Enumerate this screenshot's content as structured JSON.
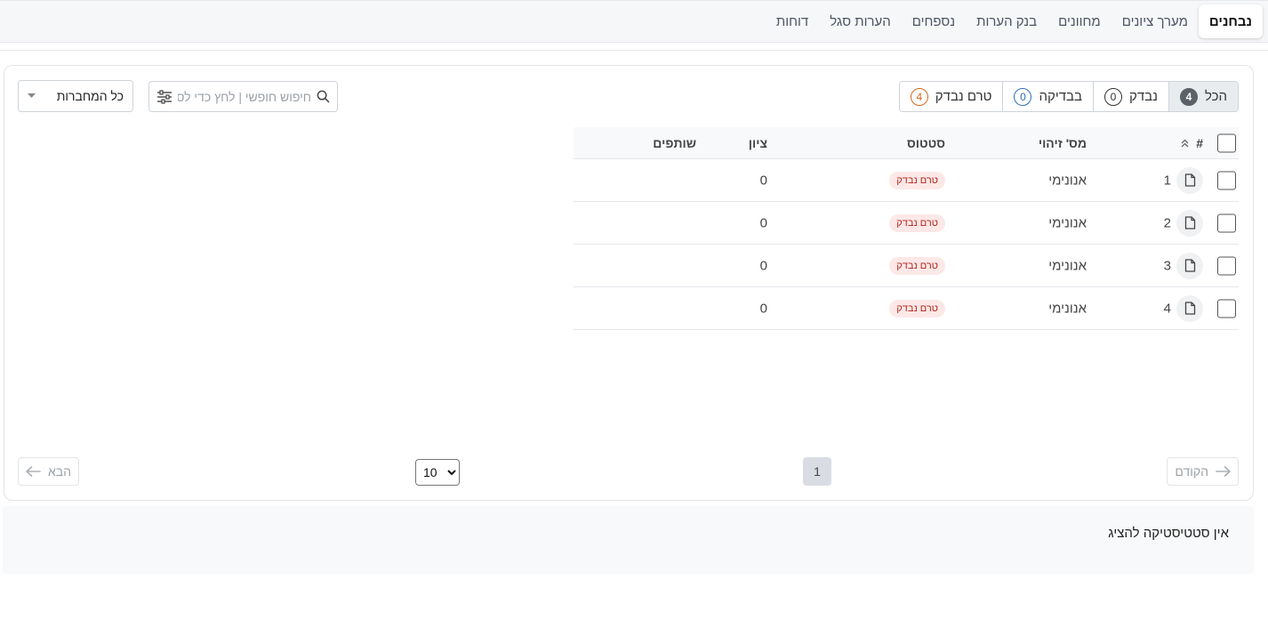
{
  "tabs": [
    {
      "label": "נבחנים",
      "active": true
    },
    {
      "label": "מערך ציונים"
    },
    {
      "label": "מחוונים"
    },
    {
      "label": "בנק הערות"
    },
    {
      "label": "נספחים"
    },
    {
      "label": "הערות סגל"
    },
    {
      "label": "דוחות"
    }
  ],
  "filters": [
    {
      "label": "הכל",
      "count": "4",
      "active": true
    },
    {
      "label": "נבדק",
      "count": "0"
    },
    {
      "label": "בבדיקה",
      "count": "0"
    },
    {
      "label": "טרם נבדק",
      "count": "4"
    }
  ],
  "search": {
    "placeholder": "חיפוש חופשי | לחץ כדי לסנן"
  },
  "notebook_select": {
    "value": "כל המחברות"
  },
  "table": {
    "headers": {
      "num": "#",
      "id": "מס' זיהוי",
      "status": "סטטוס",
      "grade": "ציון",
      "partners": "שותפים"
    },
    "rows": [
      {
        "num": "1",
        "id": "אנונימי",
        "status": "טרם נבדק",
        "grade": "0"
      },
      {
        "num": "2",
        "id": "אנונימי",
        "status": "טרם נבדק",
        "grade": "0"
      },
      {
        "num": "3",
        "id": "אנונימי",
        "status": "טרם נבדק",
        "grade": "0"
      },
      {
        "num": "4",
        "id": "אנונימי",
        "status": "טרם נבדק",
        "grade": "0"
      }
    ]
  },
  "pagination": {
    "prev_label": "הקודם",
    "next_label": "הבא",
    "current_page": "1",
    "per_page": "10"
  },
  "stats": {
    "empty_text": "אין סטטיסטיקה להציג"
  },
  "colors": {
    "status_badge_bg": "#fde8e8",
    "status_badge_text": "#b42318",
    "blue_count": "#2f6fb3",
    "orange_count": "#d2691e"
  }
}
